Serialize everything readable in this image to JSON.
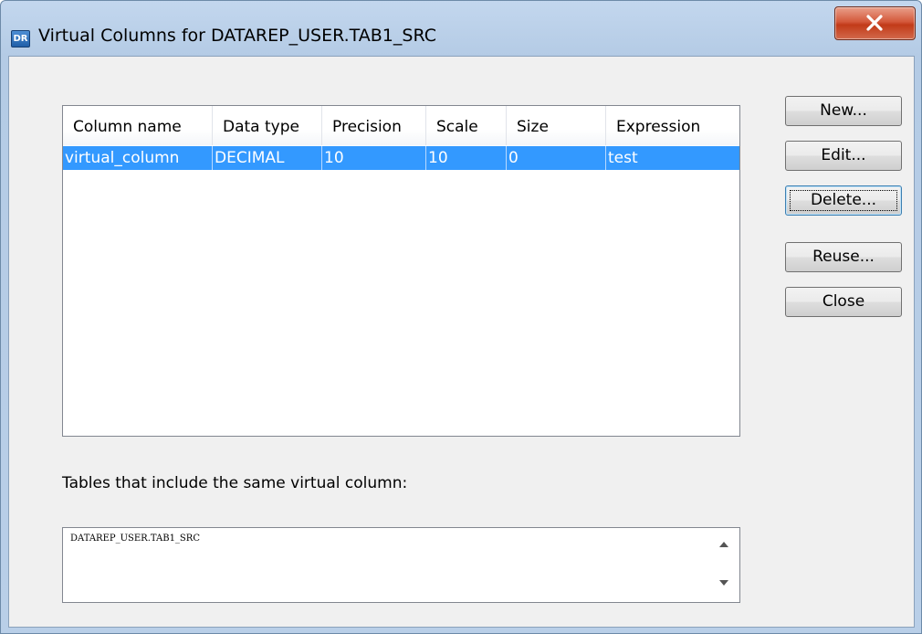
{
  "window": {
    "app_icon": "DR",
    "title": "Virtual Columns for DATAREP_USER.TAB1_SRC",
    "close_icon": "close-x-icon"
  },
  "grid": {
    "columns": [
      "Column name",
      "Data type",
      "Precision",
      "Scale",
      "Size",
      "Expression"
    ],
    "rows": [
      [
        "virtual_column",
        "DECIMAL",
        "10",
        "10",
        "0",
        "test"
      ]
    ],
    "selection_color": "#3399ff"
  },
  "buttons": {
    "new": "New...",
    "edit": "Edit...",
    "delete": "Delete...",
    "reuse": "Reuse...",
    "close": "Close"
  },
  "tables": {
    "label": "Tables that include the same virtual column:",
    "items": [
      "DATAREP_USER.TAB1_SRC"
    ]
  }
}
